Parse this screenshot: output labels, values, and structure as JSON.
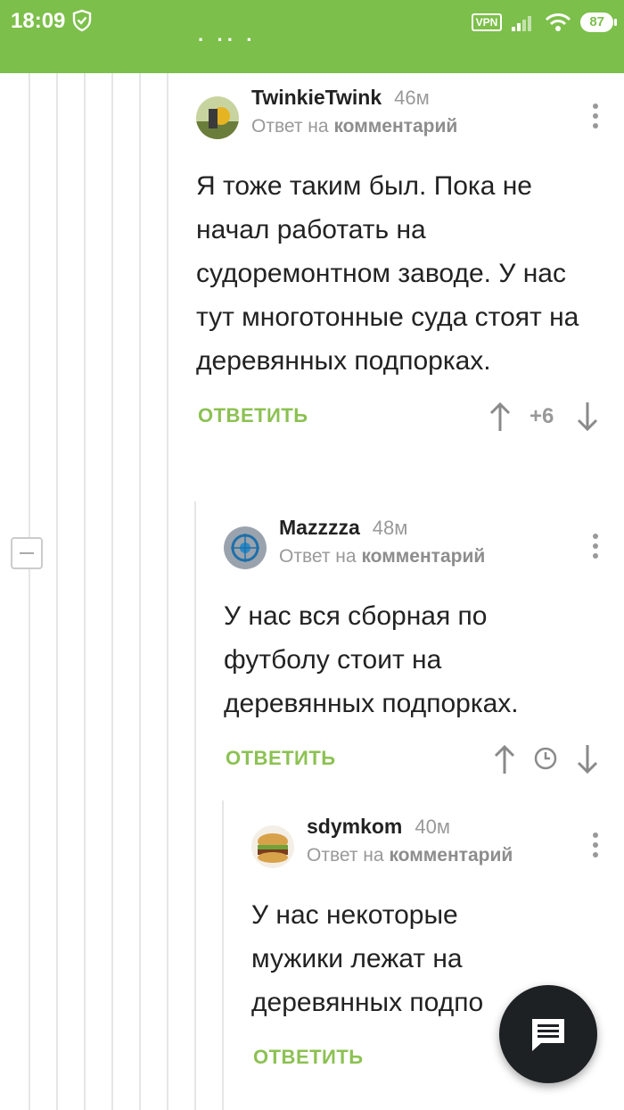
{
  "status_bar": {
    "time": "18:09",
    "dots": "· ·· ·",
    "vpn_label": "VPN",
    "battery": "87"
  },
  "comments": [
    {
      "author": "TwinkieTwink",
      "age": "46м",
      "reply_prefix": "Ответ на",
      "reply_link": "комментарий",
      "text": "Я тоже таким был. Пока не начал работать на судоремонтном заводе. У нас тут многотонные суда стоят на деревянных подпорках.",
      "reply_label": "ОТВЕТИТЬ",
      "rating": "+6"
    },
    {
      "author": "Mazzzza",
      "age": "48м",
      "reply_prefix": "Ответ на",
      "reply_link": "комментарий",
      "text": "У нас вся сборная по футболу стоит на деревянных подпорках.",
      "reply_label": "ОТВЕТИТЬ"
    },
    {
      "author": "sdymkom",
      "age": "40м",
      "reply_prefix": "Ответ на",
      "reply_link": "комментарий",
      "text": "У нас некоторые мужики лежат на деревянных подпо",
      "reply_label": "ОТВЕТИТЬ"
    }
  ],
  "icons": {
    "shield": "shield-check-icon",
    "signal": "signal-icon",
    "wifi": "wifi-icon",
    "fab": "comment-icon"
  },
  "colors": {
    "accent": "#8cc152",
    "status_bar": "#7cbf4a"
  }
}
